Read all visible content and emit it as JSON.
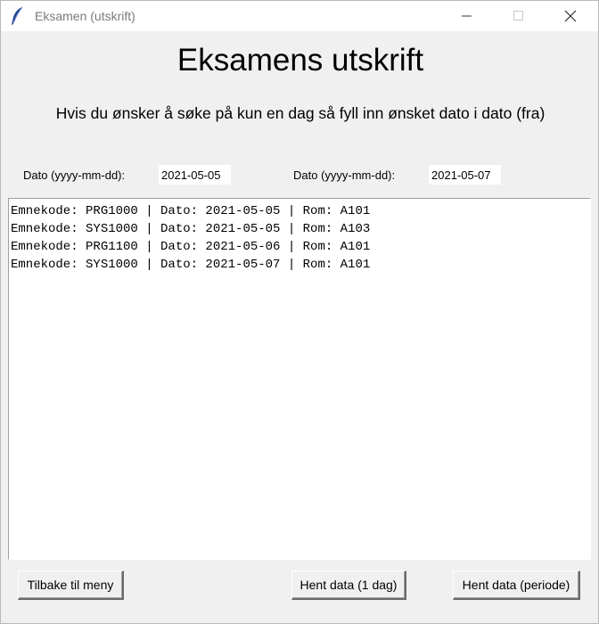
{
  "window": {
    "title": "Eksamen (utskrift)"
  },
  "header": {
    "title": "Eksamens utskrift",
    "subtitle": "Hvis du ønsker å søke på kun en dag så fyll inn ønsket dato i dato (fra)"
  },
  "form": {
    "date_from_label": "Dato (yyyy-mm-dd):",
    "date_from_value": "2021-05-05",
    "date_to_label": "Dato (yyyy-mm-dd):",
    "date_to_value": "2021-05-07"
  },
  "results": [
    "Emnekode: PRG1000 | Dato: 2021-05-05 | Rom: A101",
    "Emnekode: SYS1000 | Dato: 2021-05-05 | Rom: A103",
    "Emnekode: PRG1100 | Dato: 2021-05-06 | Rom: A101",
    "Emnekode: SYS1000 | Dato: 2021-05-07 | Rom: A101"
  ],
  "buttons": {
    "back": "Tilbake til meny",
    "fetch_day": "Hent data (1 dag)",
    "fetch_period": "Hent data (periode)"
  }
}
